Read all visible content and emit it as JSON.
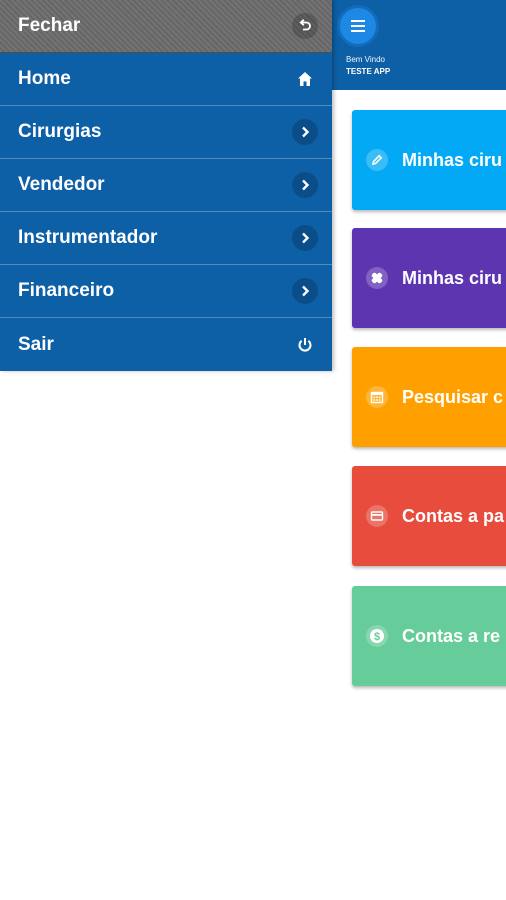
{
  "header": {
    "welcome_line1": "Bem Vindo",
    "welcome_line2": "TESTE APP"
  },
  "drawer": {
    "close_label": "Fechar",
    "items": [
      {
        "label": "Home",
        "icon": "home-icon"
      },
      {
        "label": "Cirurgias",
        "icon": "chevron-right-icon"
      },
      {
        "label": "Vendedor",
        "icon": "chevron-right-icon"
      },
      {
        "label": "Instrumentador",
        "icon": "chevron-right-icon"
      },
      {
        "label": "Financeiro",
        "icon": "chevron-right-icon"
      },
      {
        "label": "Sair",
        "icon": "power-icon"
      }
    ]
  },
  "cards": [
    {
      "label": "Minhas ciru",
      "icon": "pencil-icon",
      "color": "#03a9f4"
    },
    {
      "label": "Minhas ciru",
      "icon": "bandage-icon",
      "color": "#5e35b1"
    },
    {
      "label": "Pesquisar c",
      "icon": "calendar-icon",
      "color": "#ffa000"
    },
    {
      "label": "Contas a pa",
      "icon": "credit-card-icon",
      "color": "#e84c3d"
    },
    {
      "label": "Contas a re",
      "icon": "dollar-icon",
      "color": "#66cc99"
    }
  ]
}
